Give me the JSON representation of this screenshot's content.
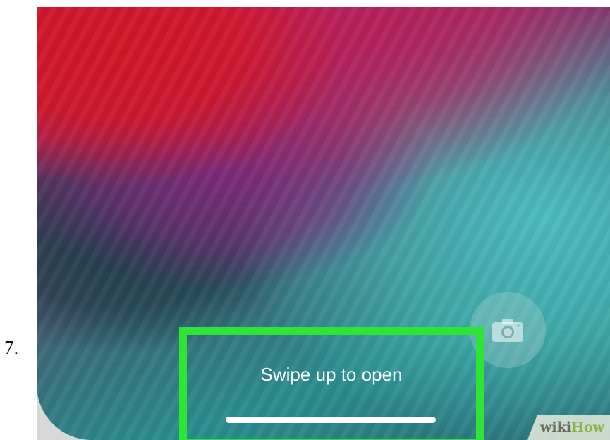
{
  "step": {
    "number": "7."
  },
  "lock_screen": {
    "swipe_text": "Swipe up to open",
    "camera_icon": "camera-icon"
  },
  "highlight": {
    "color": "#2ee535"
  },
  "watermark": {
    "part1": "wiki",
    "part2": "How"
  }
}
